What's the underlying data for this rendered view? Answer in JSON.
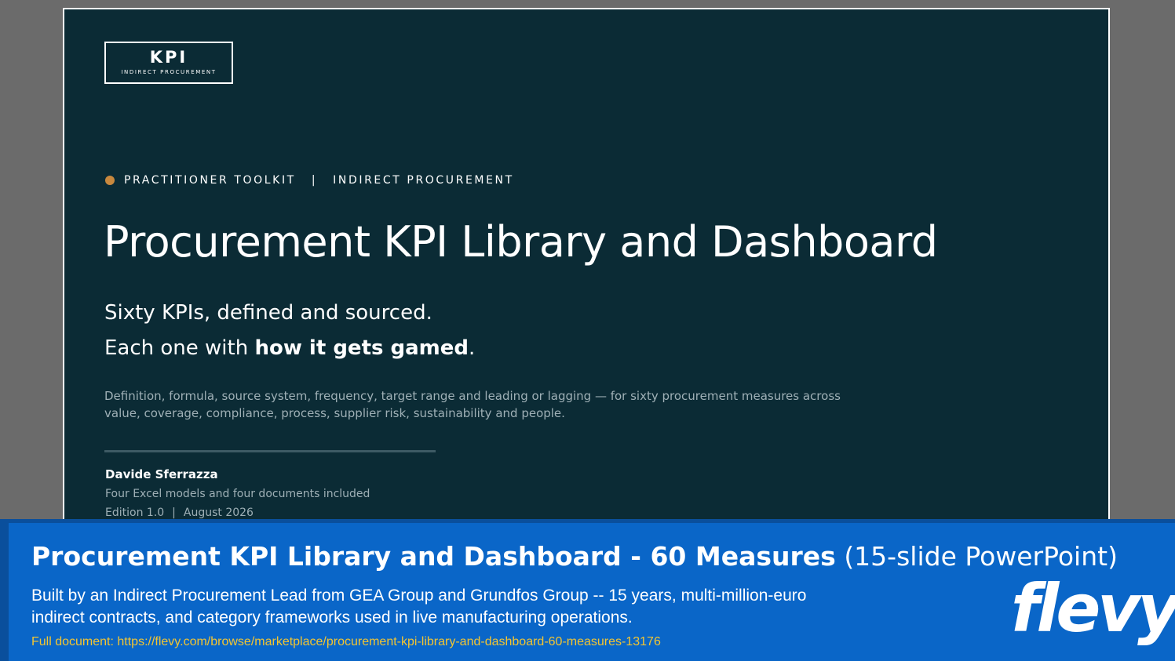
{
  "slide": {
    "logo": {
      "main": "KPI",
      "sub": "INDIRECT PROCUREMENT"
    },
    "eyebrow": {
      "left": "PRACTITIONER TOOLKIT",
      "separator": "|",
      "right": "INDIRECT PROCUREMENT"
    },
    "title": "Procurement KPI Library and Dashboard",
    "subtitle_line1": "Sixty KPIs, defined and sourced.",
    "subtitle_line2": {
      "prefix": "Each one with ",
      "emphasis": "how it gets gamed",
      "suffix": "."
    },
    "description": "Definition, formula, source system, frequency, target range and leading or lagging — for sixty procurement measures across value, coverage, compliance, process, supplier risk, sustainability and people.",
    "author": "Davide Sferrazza",
    "meta_line1": "Four Excel models and four documents included",
    "meta_line2": {
      "edition": "Edition 1.0",
      "separator": "|",
      "date": "August 2026"
    }
  },
  "banner": {
    "title_strong": "Procurement KPI Library and Dashboard - 60 Measures",
    "title_light": "(15-slide PowerPoint)",
    "description": "Built by an Indirect Procurement Lead from GEA Group and Grundfos Group -- 15 years, multi-million-euro indirect contracts, and category frameworks used in live manufacturing operations.",
    "link": "Full document: https://flevy.com/browse/marketplace/procurement-kpi-library-and-dashboard-60-measures-13176",
    "brand": "flevy"
  },
  "colors": {
    "slide_bg": "#0b2b35",
    "accent_dot": "#c8883e",
    "banner_bg": "#0a66c8",
    "link": "#f3c531"
  }
}
